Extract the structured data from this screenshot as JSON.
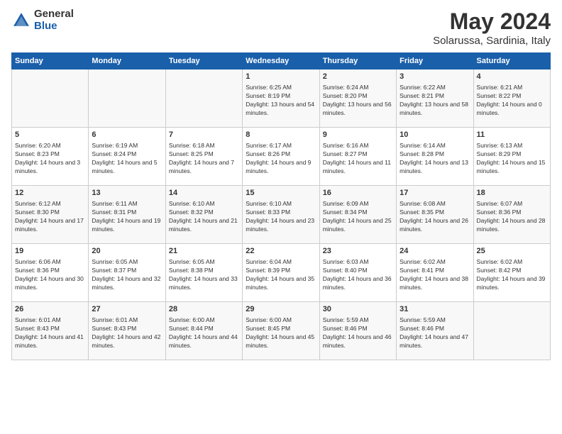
{
  "header": {
    "logo_general": "General",
    "logo_blue": "Blue",
    "title": "May 2024",
    "location": "Solarussa, Sardinia, Italy"
  },
  "days_of_week": [
    "Sunday",
    "Monday",
    "Tuesday",
    "Wednesday",
    "Thursday",
    "Friday",
    "Saturday"
  ],
  "weeks": [
    [
      {
        "day": "",
        "sunrise": "",
        "sunset": "",
        "daylight": ""
      },
      {
        "day": "",
        "sunrise": "",
        "sunset": "",
        "daylight": ""
      },
      {
        "day": "",
        "sunrise": "",
        "sunset": "",
        "daylight": ""
      },
      {
        "day": "1",
        "sunrise": "Sunrise: 6:25 AM",
        "sunset": "Sunset: 8:19 PM",
        "daylight": "Daylight: 13 hours and 54 minutes."
      },
      {
        "day": "2",
        "sunrise": "Sunrise: 6:24 AM",
        "sunset": "Sunset: 8:20 PM",
        "daylight": "Daylight: 13 hours and 56 minutes."
      },
      {
        "day": "3",
        "sunrise": "Sunrise: 6:22 AM",
        "sunset": "Sunset: 8:21 PM",
        "daylight": "Daylight: 13 hours and 58 minutes."
      },
      {
        "day": "4",
        "sunrise": "Sunrise: 6:21 AM",
        "sunset": "Sunset: 8:22 PM",
        "daylight": "Daylight: 14 hours and 0 minutes."
      }
    ],
    [
      {
        "day": "5",
        "sunrise": "Sunrise: 6:20 AM",
        "sunset": "Sunset: 8:23 PM",
        "daylight": "Daylight: 14 hours and 3 minutes."
      },
      {
        "day": "6",
        "sunrise": "Sunrise: 6:19 AM",
        "sunset": "Sunset: 8:24 PM",
        "daylight": "Daylight: 14 hours and 5 minutes."
      },
      {
        "day": "7",
        "sunrise": "Sunrise: 6:18 AM",
        "sunset": "Sunset: 8:25 PM",
        "daylight": "Daylight: 14 hours and 7 minutes."
      },
      {
        "day": "8",
        "sunrise": "Sunrise: 6:17 AM",
        "sunset": "Sunset: 8:26 PM",
        "daylight": "Daylight: 14 hours and 9 minutes."
      },
      {
        "day": "9",
        "sunrise": "Sunrise: 6:16 AM",
        "sunset": "Sunset: 8:27 PM",
        "daylight": "Daylight: 14 hours and 11 minutes."
      },
      {
        "day": "10",
        "sunrise": "Sunrise: 6:14 AM",
        "sunset": "Sunset: 8:28 PM",
        "daylight": "Daylight: 14 hours and 13 minutes."
      },
      {
        "day": "11",
        "sunrise": "Sunrise: 6:13 AM",
        "sunset": "Sunset: 8:29 PM",
        "daylight": "Daylight: 14 hours and 15 minutes."
      }
    ],
    [
      {
        "day": "12",
        "sunrise": "Sunrise: 6:12 AM",
        "sunset": "Sunset: 8:30 PM",
        "daylight": "Daylight: 14 hours and 17 minutes."
      },
      {
        "day": "13",
        "sunrise": "Sunrise: 6:11 AM",
        "sunset": "Sunset: 8:31 PM",
        "daylight": "Daylight: 14 hours and 19 minutes."
      },
      {
        "day": "14",
        "sunrise": "Sunrise: 6:10 AM",
        "sunset": "Sunset: 8:32 PM",
        "daylight": "Daylight: 14 hours and 21 minutes."
      },
      {
        "day": "15",
        "sunrise": "Sunrise: 6:10 AM",
        "sunset": "Sunset: 8:33 PM",
        "daylight": "Daylight: 14 hours and 23 minutes."
      },
      {
        "day": "16",
        "sunrise": "Sunrise: 6:09 AM",
        "sunset": "Sunset: 8:34 PM",
        "daylight": "Daylight: 14 hours and 25 minutes."
      },
      {
        "day": "17",
        "sunrise": "Sunrise: 6:08 AM",
        "sunset": "Sunset: 8:35 PM",
        "daylight": "Daylight: 14 hours and 26 minutes."
      },
      {
        "day": "18",
        "sunrise": "Sunrise: 6:07 AM",
        "sunset": "Sunset: 8:36 PM",
        "daylight": "Daylight: 14 hours and 28 minutes."
      }
    ],
    [
      {
        "day": "19",
        "sunrise": "Sunrise: 6:06 AM",
        "sunset": "Sunset: 8:36 PM",
        "daylight": "Daylight: 14 hours and 30 minutes."
      },
      {
        "day": "20",
        "sunrise": "Sunrise: 6:05 AM",
        "sunset": "Sunset: 8:37 PM",
        "daylight": "Daylight: 14 hours and 32 minutes."
      },
      {
        "day": "21",
        "sunrise": "Sunrise: 6:05 AM",
        "sunset": "Sunset: 8:38 PM",
        "daylight": "Daylight: 14 hours and 33 minutes."
      },
      {
        "day": "22",
        "sunrise": "Sunrise: 6:04 AM",
        "sunset": "Sunset: 8:39 PM",
        "daylight": "Daylight: 14 hours and 35 minutes."
      },
      {
        "day": "23",
        "sunrise": "Sunrise: 6:03 AM",
        "sunset": "Sunset: 8:40 PM",
        "daylight": "Daylight: 14 hours and 36 minutes."
      },
      {
        "day": "24",
        "sunrise": "Sunrise: 6:02 AM",
        "sunset": "Sunset: 8:41 PM",
        "daylight": "Daylight: 14 hours and 38 minutes."
      },
      {
        "day": "25",
        "sunrise": "Sunrise: 6:02 AM",
        "sunset": "Sunset: 8:42 PM",
        "daylight": "Daylight: 14 hours and 39 minutes."
      }
    ],
    [
      {
        "day": "26",
        "sunrise": "Sunrise: 6:01 AM",
        "sunset": "Sunset: 8:43 PM",
        "daylight": "Daylight: 14 hours and 41 minutes."
      },
      {
        "day": "27",
        "sunrise": "Sunrise: 6:01 AM",
        "sunset": "Sunset: 8:43 PM",
        "daylight": "Daylight: 14 hours and 42 minutes."
      },
      {
        "day": "28",
        "sunrise": "Sunrise: 6:00 AM",
        "sunset": "Sunset: 8:44 PM",
        "daylight": "Daylight: 14 hours and 44 minutes."
      },
      {
        "day": "29",
        "sunrise": "Sunrise: 6:00 AM",
        "sunset": "Sunset: 8:45 PM",
        "daylight": "Daylight: 14 hours and 45 minutes."
      },
      {
        "day": "30",
        "sunrise": "Sunrise: 5:59 AM",
        "sunset": "Sunset: 8:46 PM",
        "daylight": "Daylight: 14 hours and 46 minutes."
      },
      {
        "day": "31",
        "sunrise": "Sunrise: 5:59 AM",
        "sunset": "Sunset: 8:46 PM",
        "daylight": "Daylight: 14 hours and 47 minutes."
      },
      {
        "day": "",
        "sunrise": "",
        "sunset": "",
        "daylight": ""
      }
    ]
  ]
}
